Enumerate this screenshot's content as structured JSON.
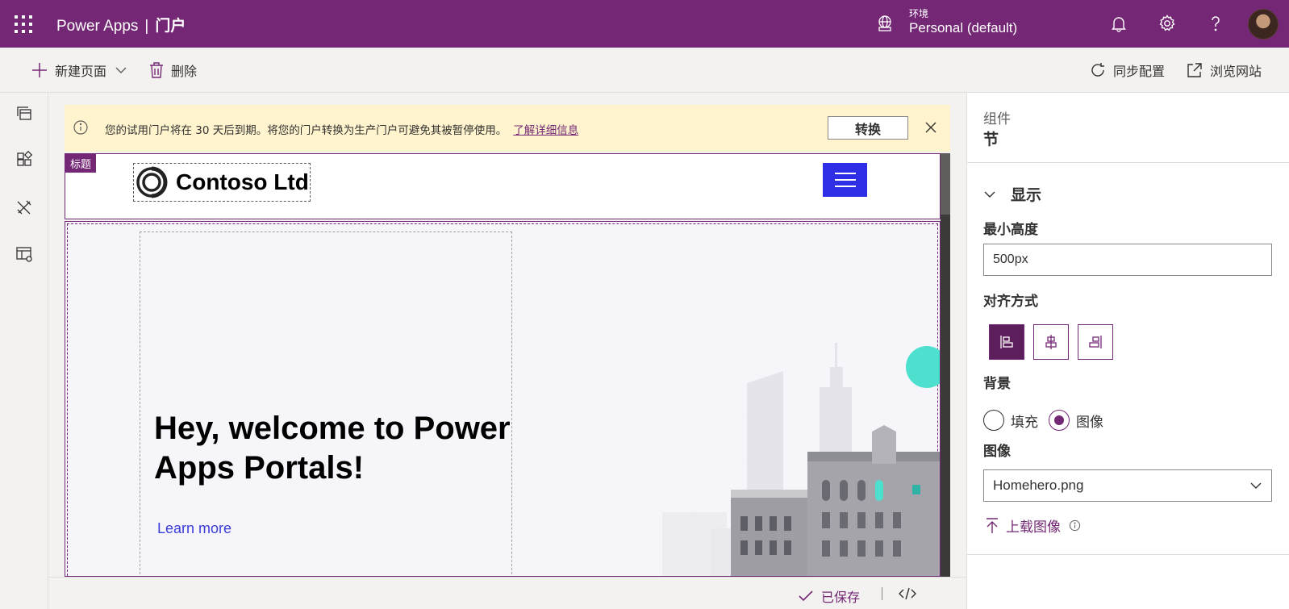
{
  "topbar": {
    "app_name": "Power Apps",
    "separator": "|",
    "portal_label": "门户",
    "environment_label": "环境",
    "environment_value": "Personal (default)"
  },
  "commands": {
    "new_page": "新建页面",
    "delete": "删除",
    "sync_config": "同步配置",
    "browse_site": "浏览网站"
  },
  "banner": {
    "message": "您的试用门户将在 30 天后到期。将您的门户转换为生产门户可避免其被暂停使用。",
    "link": "了解详细信息",
    "convert_button": "转换"
  },
  "site": {
    "header_tag": "标题",
    "company_name": "Contoso Ltd",
    "hero_title": "Hey, welcome to Power Apps Portals!",
    "hero_link": "Learn more"
  },
  "status": {
    "saved": "已保存"
  },
  "panel": {
    "subtitle": "组件",
    "title": "节",
    "section_display": "显示",
    "min_height_label": "最小高度",
    "min_height_value": "500px",
    "alignment_label": "对齐方式",
    "background_label": "背景",
    "bg_fill": "填充",
    "bg_image": "图像",
    "bg_selected": "图像",
    "image_label": "图像",
    "image_value": "Homehero.png",
    "upload_image": "上载图像"
  },
  "colors": {
    "brand": "#742774",
    "hamburger": "#2e2ee6",
    "banner_bg": "#fff4ce",
    "link_blue": "#3b3bd9"
  }
}
